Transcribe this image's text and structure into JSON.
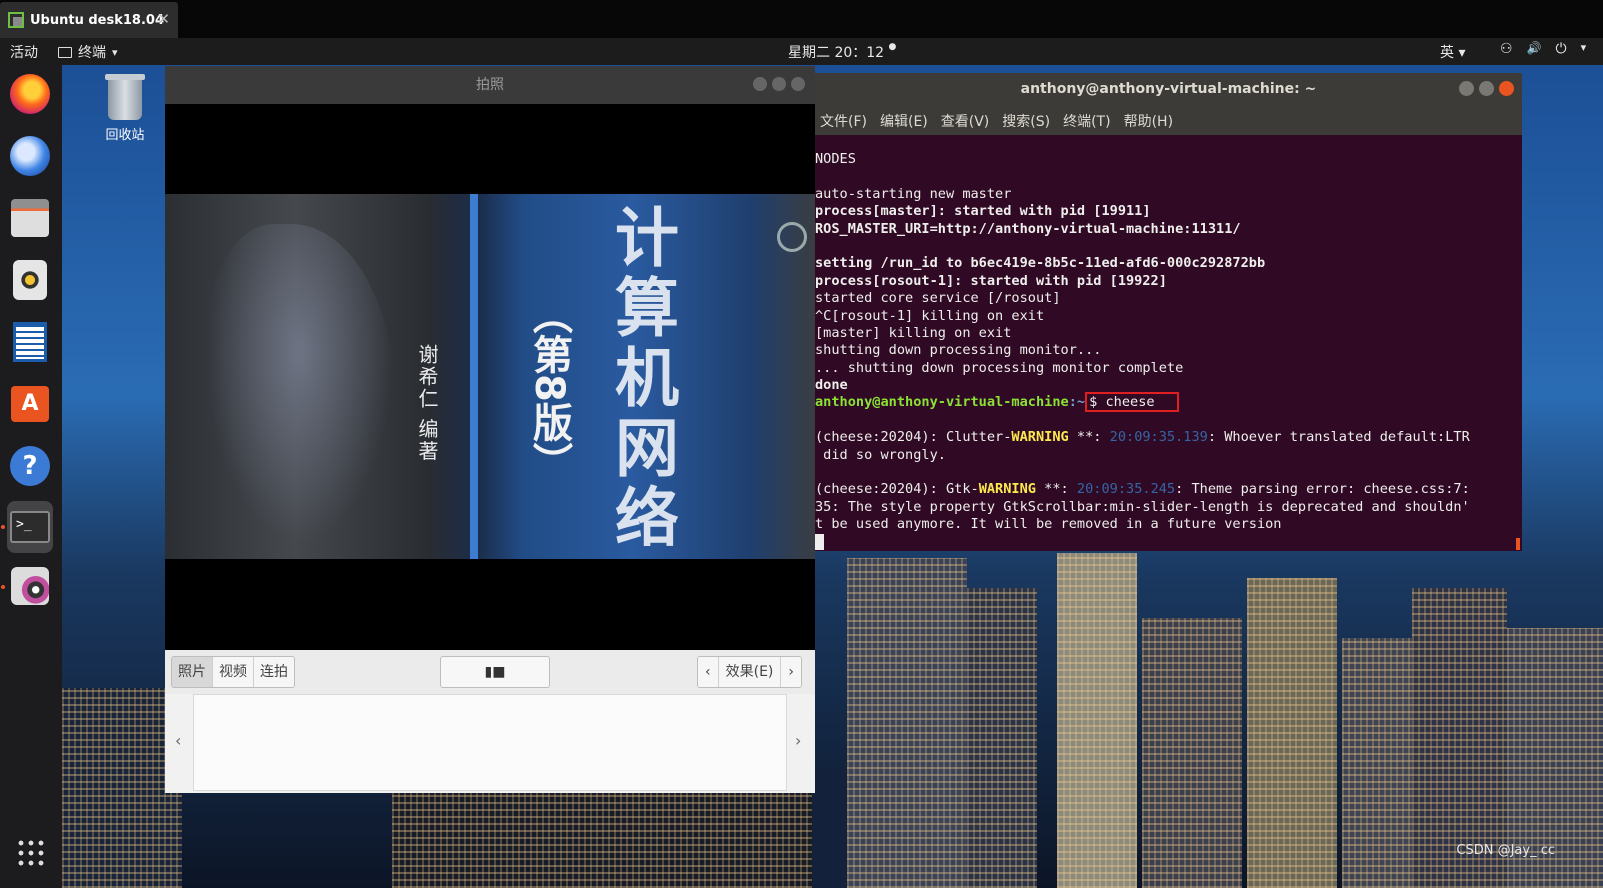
{
  "vm": {
    "tab_title": "Ubuntu desk18.04",
    "tab_close": "✕"
  },
  "topbar": {
    "activities": "活动",
    "app_menu": "终端",
    "app_menu_arrow": "▾",
    "clock": "星期二 20：12",
    "clock_dot": "●",
    "input_method": "英 ▾",
    "tray_icons": [
      "network-icon",
      "volume-icon",
      "power-icon"
    ],
    "tray_glyphs": {
      "network": "⚇",
      "volume": "🔊",
      "power": "⏻",
      "arrow": "▾"
    }
  },
  "desktop": {
    "trash_label": "回收站"
  },
  "dock": {
    "icons": [
      "firefox-icon",
      "thunderbird-icon",
      "files-icon",
      "rhythmbox-icon",
      "writer-icon",
      "software-icon",
      "help-icon",
      "terminal-icon",
      "cheese-icon",
      "show-apps-icon"
    ],
    "help_glyph": "?",
    "software_glyph": "A",
    "terminal_glyph": ">_"
  },
  "cheese": {
    "title": "拍照",
    "webcam_text": {
      "book_title": "计算机网络",
      "edition": "（第8版）",
      "author": "谢希仁 编著"
    },
    "modes": [
      "照片",
      "视频",
      "连拍"
    ],
    "shutter_glyph": "▮■",
    "effects_label": "效果(E)",
    "prev_glyph": "‹",
    "next_glyph": "›"
  },
  "terminal": {
    "title": "anthony@anthony-virtual-machine: ~",
    "menu": [
      "文件(F)",
      "编辑(E)",
      "查看(V)",
      "搜索(S)",
      "终端(T)",
      "帮助(H)"
    ],
    "lines": {
      "l0": "NODES",
      "l1": "",
      "l2": "auto-starting new master",
      "l3": "process[master]: started with pid [19911]",
      "l4": "ROS_MASTER_URI=http://anthony-virtual-machine:11311/",
      "l5": "",
      "l6": "setting /run_id to b6ec419e-8b5c-11ed-afd6-000c292872bb",
      "l7": "process[rosout-1]: started with pid [19922]",
      "l8": "started core service [/rosout]",
      "l9": "^C[rosout-1] killing on exit",
      "l10": "[master] killing on exit",
      "l11": "shutting down processing monitor...",
      "l12": "... shutting down processing monitor complete",
      "l13": "done"
    },
    "prompt": {
      "user_host": "anthony@anthony-virtual-machine",
      "path": ":~",
      "command": "$ cheese"
    },
    "warn1": {
      "prefix": "(cheese:20204): Clutter-",
      "level": "WARNING",
      "mid": " **: ",
      "time": "20:09:35.139",
      "msg": ": Whoever translated default:LTR",
      "cont": " did so wrongly."
    },
    "warn2": {
      "prefix": "(cheese:20204): Gtk-",
      "level": "WARNING",
      "mid": " **: ",
      "time": "20:09:35.245",
      "msg": ": Theme parsing error: cheese.css:7:",
      "cont1": "35: The style property GtkScrollbar:min-slider-length is deprecated and shouldn'",
      "cont2": "t be used anymore. It will be removed in a future version"
    }
  },
  "watermark": "CSDN @Jay_ cc"
}
